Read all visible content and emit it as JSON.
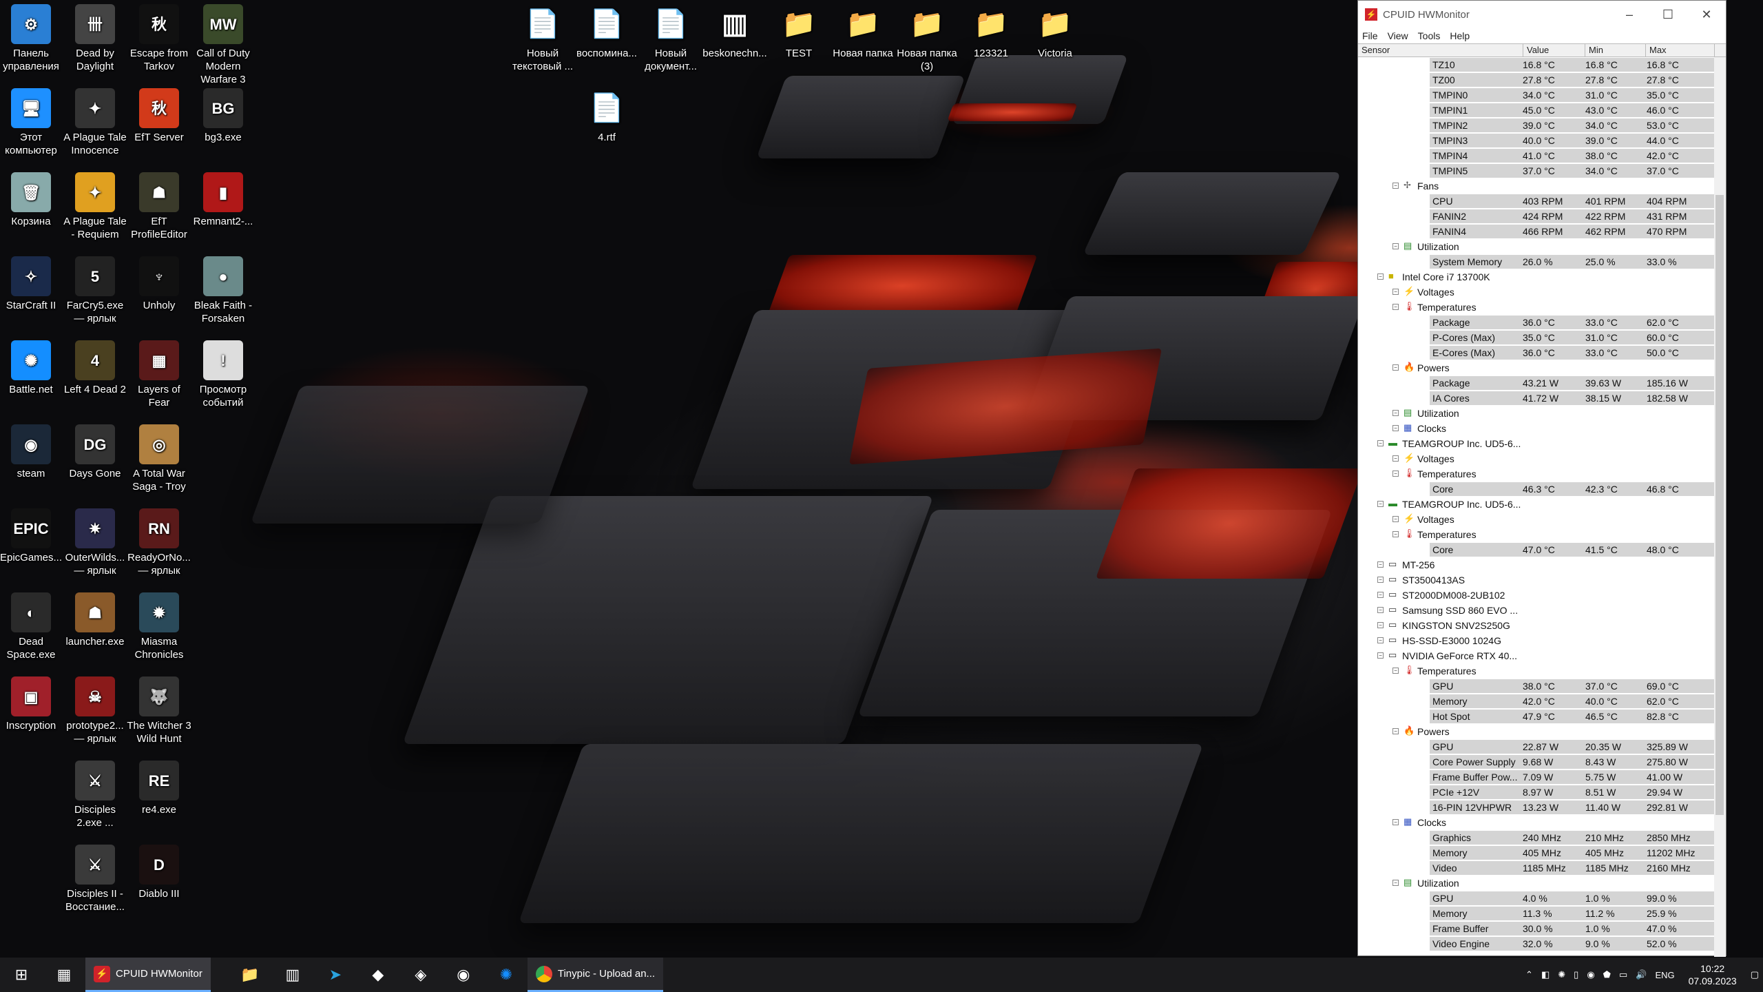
{
  "desktop_icons": [
    {
      "label": "Панель управления",
      "icon": "control-panel-icon",
      "color": "#2a7fd4",
      "glyph": "⚙"
    },
    {
      "label": "Dead by Daylight",
      "icon": "dead-by-daylight-icon",
      "color": "#444",
      "glyph": "卌"
    },
    {
      "label": "Escape from Tarkov",
      "icon": "tarkov-icon",
      "color": "#111",
      "glyph": "秋"
    },
    {
      "label": "Call of Duty Modern Warfare 3",
      "icon": "cod-icon",
      "color": "#3a4a2a",
      "glyph": "MW"
    },
    {
      "label": "Этот компьютер",
      "icon": "this-pc-icon",
      "color": "#1e90ff",
      "glyph": "🖥"
    },
    {
      "label": "A Plague Tale Innocence",
      "icon": "plague-tale-icon",
      "color": "#333",
      "glyph": "✦"
    },
    {
      "label": "EfT Server",
      "icon": "eft-server-icon",
      "color": "#d23a1a",
      "glyph": "秋"
    },
    {
      "label": "bg3.exe",
      "icon": "bg3-icon",
      "color": "#2a2a2a",
      "glyph": "BG"
    },
    {
      "label": "Корзина",
      "icon": "recycle-bin-icon",
      "color": "#8aa",
      "glyph": "🗑"
    },
    {
      "label": "A Plague Tale - Requiem",
      "icon": "plague-tale-requiem-icon",
      "color": "#e0a020",
      "glyph": "✦"
    },
    {
      "label": "EfT ProfileEditor",
      "icon": "eft-profile-editor-icon",
      "color": "#3a3a2a",
      "glyph": "☗"
    },
    {
      "label": "Remnant2-...",
      "icon": "remnant2-icon",
      "color": "#b01818",
      "glyph": "▮"
    },
    {
      "label": "StarCraft II",
      "icon": "starcraft-icon",
      "color": "#1a2a4a",
      "glyph": "✧"
    },
    {
      "label": "FarCry5.exe — ярлык",
      "icon": "farcry5-icon",
      "color": "#222",
      "glyph": "5"
    },
    {
      "label": "Unholy",
      "icon": "unholy-icon",
      "color": "#111",
      "glyph": "♆"
    },
    {
      "label": "Bleak Faith - Forsaken",
      "icon": "bleak-faith-icon",
      "color": "#6a8a8a",
      "glyph": "●"
    },
    {
      "label": "Battle.net",
      "icon": "battlenet-icon",
      "color": "#148eff",
      "glyph": "✺"
    },
    {
      "label": "Left 4 Dead 2",
      "icon": "left4dead-icon",
      "color": "#4a4020",
      "glyph": "4"
    },
    {
      "label": "Layers of Fear",
      "icon": "layers-of-fear-icon",
      "color": "#5a1a1a",
      "glyph": "▦"
    },
    {
      "label": "Просмотр событий",
      "icon": "event-viewer-icon",
      "color": "#ddd",
      "glyph": "!"
    },
    {
      "label": "steam",
      "icon": "steam-icon",
      "color": "#1b2838",
      "glyph": "◉"
    },
    {
      "label": "Days Gone",
      "icon": "days-gone-icon",
      "color": "#333",
      "glyph": "DG"
    },
    {
      "label": "A Total War Saga - Troy",
      "icon": "troy-icon",
      "color": "#b08040",
      "glyph": "◎"
    },
    {
      "label": "",
      "icon": "blank-icon",
      "color": "transparent",
      "glyph": ""
    },
    {
      "label": "EpicGames...",
      "icon": "epic-games-icon",
      "color": "#111",
      "glyph": "EPIC"
    },
    {
      "label": "OuterWilds... — ярлык",
      "icon": "outer-wilds-icon",
      "color": "#2a2a4a",
      "glyph": "✷"
    },
    {
      "label": "ReadyOrNo... — ярлык",
      "icon": "ready-or-not-icon",
      "color": "#5a1a1a",
      "glyph": "RN"
    },
    {
      "label": "",
      "icon": "blank-icon",
      "color": "transparent",
      "glyph": ""
    },
    {
      "label": "Dead Space.exe",
      "icon": "dead-space-icon",
      "color": "#2a2a2a",
      "glyph": "◐"
    },
    {
      "label": "launcher.exe",
      "icon": "launcher-icon",
      "color": "#8a5a2a",
      "glyph": "☗"
    },
    {
      "label": "Miasma Chronicles",
      "icon": "miasma-icon",
      "color": "#2a4a5a",
      "glyph": "✹"
    },
    {
      "label": "",
      "icon": "blank-icon",
      "color": "transparent",
      "glyph": ""
    },
    {
      "label": "Inscryption",
      "icon": "inscryption-icon",
      "color": "#a0202a",
      "glyph": "▣"
    },
    {
      "label": "prototype2... — ярлык",
      "icon": "prototype2-icon",
      "color": "#8a1a1a",
      "glyph": "☠"
    },
    {
      "label": "The Witcher 3 Wild Hunt",
      "icon": "witcher3-icon",
      "color": "#333",
      "glyph": "🐺"
    },
    {
      "label": "",
      "icon": "blank-icon",
      "color": "transparent",
      "glyph": ""
    },
    {
      "label": "",
      "icon": "blank-icon",
      "color": "transparent",
      "glyph": ""
    },
    {
      "label": "Disciples 2.exe ...",
      "icon": "disciples2-icon",
      "color": "#3a3a3a",
      "glyph": "⚔"
    },
    {
      "label": "re4.exe",
      "icon": "re4-icon",
      "color": "#2a2a2a",
      "glyph": "RE"
    },
    {
      "label": "",
      "icon": "blank-icon",
      "color": "transparent",
      "glyph": ""
    },
    {
      "label": "",
      "icon": "blank-icon",
      "color": "transparent",
      "glyph": ""
    },
    {
      "label": "Disciples II - Восстание...",
      "icon": "disciples2-rise-icon",
      "color": "#3a3a3a",
      "glyph": "⚔"
    },
    {
      "label": "Diablo III",
      "icon": "diablo3-icon",
      "color": "#1a1010",
      "glyph": "D"
    }
  ],
  "top_icons": [
    {
      "label": "Новый текстовый ...",
      "icon": "text-file-icon",
      "glyph": "📄"
    },
    {
      "label": "воспомина...",
      "icon": "text-file-icon",
      "glyph": "📄"
    },
    {
      "label": "Новый документ...",
      "icon": "document-icon",
      "glyph": "📄"
    },
    {
      "label": "beskonechn...",
      "icon": "image-file-icon",
      "glyph": "▥"
    },
    {
      "label": "TEST",
      "icon": "folder-icon",
      "glyph": "📁"
    },
    {
      "label": "Новая папка",
      "icon": "folder-icon",
      "glyph": "📁"
    },
    {
      "label": "Новая папка (3)",
      "icon": "folder-icon",
      "glyph": "📁"
    },
    {
      "label": "123321",
      "icon": "folder-icon",
      "glyph": "📁"
    },
    {
      "label": "Victoria",
      "icon": "folder-icon",
      "glyph": "📁"
    },
    {
      "label": "4.rtf",
      "icon": "rtf-file-icon",
      "glyph": "📄"
    }
  ],
  "hwmonitor": {
    "title": "CPUID HWMonitor",
    "menu": [
      "File",
      "View",
      "Tools",
      "Help"
    ],
    "columns": [
      "Sensor",
      "Value",
      "Min",
      "Max"
    ],
    "rows": [
      {
        "type": "leaf",
        "name": "TZ10",
        "val": "16.8 °C",
        "min": "16.8 °C",
        "max": "16.8 °C"
      },
      {
        "type": "leaf",
        "name": "TZ00",
        "val": "27.8 °C",
        "min": "27.8 °C",
        "max": "27.8 °C"
      },
      {
        "type": "leaf",
        "name": "TMPIN0",
        "val": "34.0 °C",
        "min": "31.0 °C",
        "max": "35.0 °C"
      },
      {
        "type": "leaf",
        "name": "TMPIN1",
        "val": "45.0 °C",
        "min": "43.0 °C",
        "max": "46.0 °C"
      },
      {
        "type": "leaf",
        "name": "TMPIN2",
        "val": "39.0 °C",
        "min": "34.0 °C",
        "max": "53.0 °C"
      },
      {
        "type": "leaf",
        "name": "TMPIN3",
        "val": "40.0 °C",
        "min": "39.0 °C",
        "max": "44.0 °C"
      },
      {
        "type": "leaf",
        "name": "TMPIN4",
        "val": "41.0 °C",
        "min": "38.0 °C",
        "max": "42.0 °C"
      },
      {
        "type": "leaf",
        "name": "TMPIN5",
        "val": "37.0 °C",
        "min": "34.0 °C",
        "max": "37.0 °C"
      },
      {
        "type": "group",
        "level": 1,
        "name": "Fans",
        "icon": "fan-icon"
      },
      {
        "type": "leaf",
        "name": "CPU",
        "val": "403 RPM",
        "min": "401 RPM",
        "max": "404 RPM"
      },
      {
        "type": "leaf",
        "name": "FANIN2",
        "val": "424 RPM",
        "min": "422 RPM",
        "max": "431 RPM"
      },
      {
        "type": "leaf",
        "name": "FANIN4",
        "val": "466 RPM",
        "min": "462 RPM",
        "max": "470 RPM"
      },
      {
        "type": "group",
        "level": 1,
        "name": "Utilization",
        "icon": "utilization-icon"
      },
      {
        "type": "leaf",
        "name": "System Memory",
        "val": "26.0 %",
        "min": "25.0 %",
        "max": "33.0 %"
      },
      {
        "type": "group",
        "level": 0,
        "name": "Intel Core i7 13700K",
        "icon": "cpu-chip-icon"
      },
      {
        "type": "group",
        "level": 1,
        "name": "Voltages",
        "icon": "voltage-icon"
      },
      {
        "type": "group",
        "level": 1,
        "name": "Temperatures",
        "icon": "thermometer-icon"
      },
      {
        "type": "leaf",
        "name": "Package",
        "val": "36.0 °C",
        "min": "33.0 °C",
        "max": "62.0 °C"
      },
      {
        "type": "leaf",
        "name": "P-Cores (Max)",
        "val": "35.0 °C",
        "min": "31.0 °C",
        "max": "60.0 °C"
      },
      {
        "type": "leaf",
        "name": "E-Cores (Max)",
        "val": "36.0 °C",
        "min": "33.0 °C",
        "max": "50.0 °C"
      },
      {
        "type": "group",
        "level": 1,
        "name": "Powers",
        "icon": "power-flame-icon"
      },
      {
        "type": "leaf",
        "name": "Package",
        "val": "43.21 W",
        "min": "39.63 W",
        "max": "185.16 W"
      },
      {
        "type": "leaf",
        "name": "IA Cores",
        "val": "41.72 W",
        "min": "38.15 W",
        "max": "182.58 W"
      },
      {
        "type": "group",
        "level": 1,
        "name": "Utilization",
        "icon": "utilization-icon"
      },
      {
        "type": "group",
        "level": 1,
        "name": "Clocks",
        "icon": "clock-chip-icon"
      },
      {
        "type": "group",
        "level": 0,
        "name": "TEAMGROUP Inc. UD5-6...",
        "icon": "memory-module-icon"
      },
      {
        "type": "group",
        "level": 1,
        "name": "Voltages",
        "icon": "voltage-icon"
      },
      {
        "type": "group",
        "level": 1,
        "name": "Temperatures",
        "icon": "thermometer-icon"
      },
      {
        "type": "leaf",
        "name": "Core",
        "val": "46.3 °C",
        "min": "42.3 °C",
        "max": "46.8 °C"
      },
      {
        "type": "group",
        "level": 0,
        "name": "TEAMGROUP Inc. UD5-6...",
        "icon": "memory-module-icon"
      },
      {
        "type": "group",
        "level": 1,
        "name": "Voltages",
        "icon": "voltage-icon"
      },
      {
        "type": "group",
        "level": 1,
        "name": "Temperatures",
        "icon": "thermometer-icon"
      },
      {
        "type": "leaf",
        "name": "Core",
        "val": "47.0 °C",
        "min": "41.5 °C",
        "max": "48.0 °C"
      },
      {
        "type": "group",
        "level": 0,
        "name": "MT-256",
        "icon": "drive-icon"
      },
      {
        "type": "group",
        "level": 0,
        "name": "ST3500413AS",
        "icon": "drive-icon"
      },
      {
        "type": "group",
        "level": 0,
        "name": "ST2000DM008-2UB102",
        "icon": "drive-icon"
      },
      {
        "type": "group",
        "level": 0,
        "name": "Samsung SSD 860 EVO ...",
        "icon": "drive-icon"
      },
      {
        "type": "group",
        "level": 0,
        "name": "KINGSTON SNV2S250G",
        "icon": "drive-icon"
      },
      {
        "type": "group",
        "level": 0,
        "name": "HS-SSD-E3000 1024G",
        "icon": "drive-icon"
      },
      {
        "type": "group",
        "level": 0,
        "name": "NVIDIA GeForce RTX 40...",
        "icon": "gpu-icon"
      },
      {
        "type": "group",
        "level": 1,
        "name": "Temperatures",
        "icon": "thermometer-icon"
      },
      {
        "type": "leaf",
        "name": "GPU",
        "val": "38.0 °C",
        "min": "37.0 °C",
        "max": "69.0 °C"
      },
      {
        "type": "leaf",
        "name": "Memory",
        "val": "42.0 °C",
        "min": "40.0 °C",
        "max": "62.0 °C"
      },
      {
        "type": "leaf",
        "name": "Hot Spot",
        "val": "47.9 °C",
        "min": "46.5 °C",
        "max": "82.8 °C"
      },
      {
        "type": "group",
        "level": 1,
        "name": "Powers",
        "icon": "power-flame-icon"
      },
      {
        "type": "leaf",
        "name": "GPU",
        "val": "22.87 W",
        "min": "20.35 W",
        "max": "325.89 W"
      },
      {
        "type": "leaf",
        "name": "Core Power Supply",
        "val": "9.68 W",
        "min": "8.43 W",
        "max": "275.80 W"
      },
      {
        "type": "leaf",
        "name": "Frame Buffer Pow...",
        "val": "7.09 W",
        "min": "5.75 W",
        "max": "41.00 W"
      },
      {
        "type": "leaf",
        "name": "PCIe +12V",
        "val": "8.97 W",
        "min": "8.51 W",
        "max": "29.94 W"
      },
      {
        "type": "leaf",
        "name": "16-PIN 12VHPWR",
        "val": "13.23 W",
        "min": "11.40 W",
        "max": "292.81 W"
      },
      {
        "type": "group",
        "level": 1,
        "name": "Clocks",
        "icon": "clock-chip-icon"
      },
      {
        "type": "leaf",
        "name": "Graphics",
        "val": "240 MHz",
        "min": "210 MHz",
        "max": "2850 MHz"
      },
      {
        "type": "leaf",
        "name": "Memory",
        "val": "405 MHz",
        "min": "405 MHz",
        "max": "11202 MHz"
      },
      {
        "type": "leaf",
        "name": "Video",
        "val": "1185 MHz",
        "min": "1185 MHz",
        "max": "2160 MHz"
      },
      {
        "type": "group",
        "level": 1,
        "name": "Utilization",
        "icon": "utilization-icon"
      },
      {
        "type": "leaf",
        "name": "GPU",
        "val": "4.0 %",
        "min": "1.0 %",
        "max": "99.0 %"
      },
      {
        "type": "leaf",
        "name": "Memory",
        "val": "11.3 %",
        "min": "11.2 %",
        "max": "25.9 %"
      },
      {
        "type": "leaf",
        "name": "Frame Buffer",
        "val": "30.0 %",
        "min": "1.0 %",
        "max": "47.0 %"
      },
      {
        "type": "leaf",
        "name": "Video Engine",
        "val": "32.0 %",
        "min": "9.0 %",
        "max": "52.0 %"
      }
    ]
  },
  "taskbar": {
    "apps": [
      {
        "label": "CPUID HWMonitor",
        "icon": "hwmonitor-icon",
        "active": true
      },
      {
        "label": "Tinypic - Upload an...",
        "icon": "chrome-icon",
        "active": true
      }
    ],
    "pinned": [
      "file-explorer-icon",
      "hwinfo-icon",
      "telegram-icon",
      "app-icon",
      "wolf-icon",
      "steam-icon",
      "battlenet-icon"
    ],
    "language": "ENG",
    "time": "10:22",
    "date": "07.09.2023"
  }
}
